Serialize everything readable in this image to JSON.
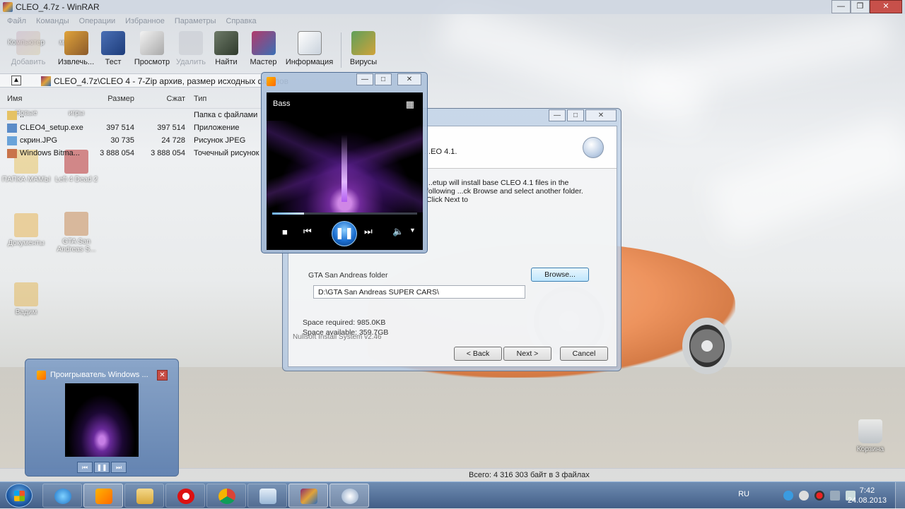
{
  "winrar": {
    "title": "CLEO_4.7z - WinRAR",
    "menu": [
      "Файл",
      "Команды",
      "Операции",
      "Избранное",
      "Параметры",
      "Справка"
    ],
    "toolbar": [
      {
        "label": "Добавить",
        "icon": "add-archive-icon",
        "disabled": true
      },
      {
        "label": "Извлечь...",
        "icon": "extract-icon",
        "disabled": false
      },
      {
        "label": "Тест",
        "icon": "test-icon",
        "disabled": false
      },
      {
        "label": "Просмотр",
        "icon": "view-icon",
        "disabled": false
      },
      {
        "label": "Удалить",
        "icon": "delete-icon",
        "disabled": true
      },
      {
        "label": "Найти",
        "icon": "find-icon",
        "disabled": false
      },
      {
        "label": "Мастер",
        "icon": "wizard-icon",
        "disabled": false
      },
      {
        "label": "Информация",
        "icon": "info-icon",
        "disabled": false
      },
      {
        "label": "Вирусы",
        "icon": "virus-scan-icon",
        "disabled": false
      }
    ],
    "address": "CLEO_4.7z\\CLEO 4 - 7-Zip архив, размер исходных файлов",
    "columns": {
      "name": "Имя",
      "size": "Размер",
      "packed": "Сжат",
      "type": "Тип"
    },
    "files": [
      {
        "name": "..",
        "size": "",
        "packed": "",
        "type": "Папка с файлами"
      },
      {
        "name": "CLEO4_setup.exe",
        "size": "397 514",
        "packed": "397 514",
        "type": "Приложение"
      },
      {
        "name": "скрин.JPG",
        "size": "30 735",
        "packed": "24 728",
        "type": "Рисунок JPEG"
      },
      {
        "name": "Windows Bitma...",
        "size": "3 888 054",
        "packed": "3 888 054",
        "type": "Точечный рисунок"
      }
    ],
    "status": "Всего: 4 316 303 байт в 3 файлах"
  },
  "desktop_icons": [
    {
      "label": "Компьютер"
    },
    {
      "label": "музыка"
    },
    {
      "label": "Новые"
    },
    {
      "label": "игры"
    },
    {
      "label": "ПАПКА МАМЫ"
    },
    {
      "label": "Left 4 Dead 2"
    },
    {
      "label": "Документы"
    },
    {
      "label": "GTA San Andreas S..."
    },
    {
      "label": "Вадим"
    },
    {
      "label": "Корзина"
    }
  ],
  "installer": {
    "header_text": "...EO 4.1.",
    "description": "...etup will install base CLEO 4.1 files in the following ...ck Browse and select another folder. Click Next to",
    "folder_group": "GTA San Andreas folder",
    "path_value": "D:\\GTA San Andreas SUPER CARS\\",
    "browse": "Browse...",
    "space_required": "Space required: 985.0KB",
    "space_available": "Space available: 359.7GB",
    "nsis": "Nullsoft Install System v2.46",
    "back": "< Back",
    "next": "Next >",
    "cancel": "Cancel"
  },
  "media_player": {
    "track": "Bass",
    "progress_fraction": 0.22
  },
  "thumbnail": {
    "title": "Проигрыватель Windows ..."
  },
  "taskbar": {
    "lang": "RU",
    "time": "7:42",
    "date": "24.08.2013"
  },
  "colors": {
    "accent": "#1b6fd1",
    "close_red": "#c7504a",
    "taskbar": "#3f6596"
  }
}
